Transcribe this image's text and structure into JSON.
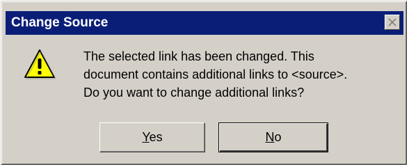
{
  "dialog": {
    "title": "Change Source",
    "message_lines": [
      "The selected link has been changed. This",
      "document contains additional links to <source>.",
      "Do you want to change additional links?"
    ],
    "icon": "warning-icon",
    "buttons": {
      "yes": {
        "mnemonic": "Y",
        "rest": "es"
      },
      "no": {
        "mnemonic": "N",
        "rest": "o"
      }
    }
  },
  "colors": {
    "titlebar": "#0a1e78",
    "face": "#d4d0c8",
    "warning_fill": "#ffff00"
  }
}
